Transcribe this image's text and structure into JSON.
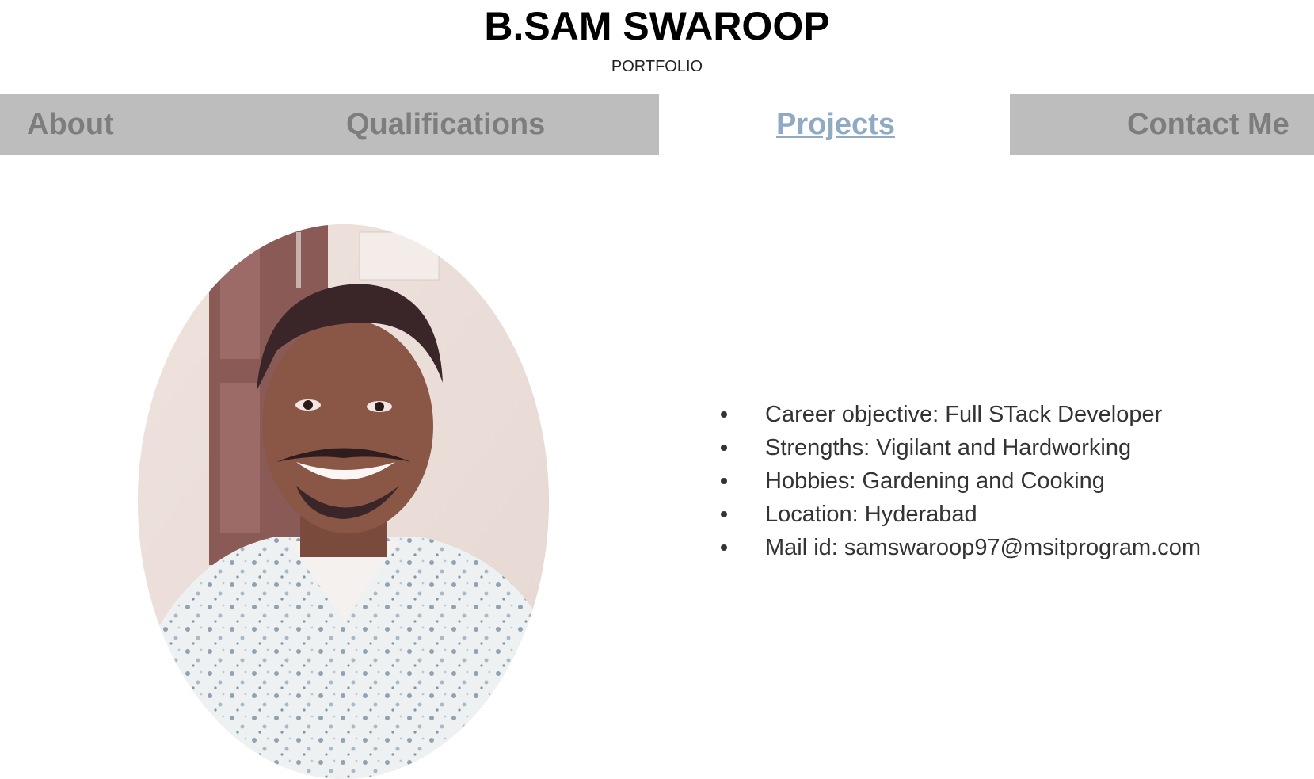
{
  "header": {
    "title": "B.SAM SWAROOP",
    "subtitle": "PORTFOLIO"
  },
  "nav": {
    "items": [
      {
        "label": "About",
        "active": false
      },
      {
        "label": "Qualifications",
        "active": false
      },
      {
        "label": "Projects",
        "active": true
      },
      {
        "label": "Contact Me",
        "active": false
      }
    ]
  },
  "info": {
    "items": [
      "Career objective: Full STack Developer",
      "Strengths: Vigilant and Hardworking",
      "Hobbies: Gardening and Cooking",
      "Location: Hyderabad",
      "Mail id: samswaroop97@msitprogram.com"
    ]
  },
  "colors": {
    "nav_background": "#bdbdbd",
    "nav_text": "#7d7d7d",
    "nav_active_text": "#8faac2",
    "body_text": "#333333"
  }
}
